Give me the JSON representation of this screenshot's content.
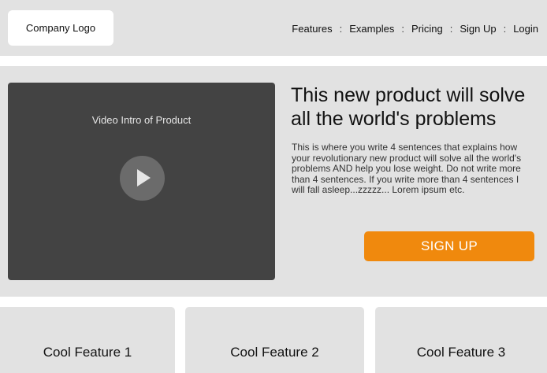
{
  "header": {
    "logo_text": "Company Logo",
    "nav": [
      "Features",
      "Examples",
      "Pricing",
      "Sign Up",
      "Login"
    ],
    "separator": ":"
  },
  "hero": {
    "video_caption": "Video Intro of Product",
    "play_icon": "play-icon",
    "headline": "This new product will solve all the world's problems",
    "body": "This is where you write 4 sentences that explains how your revolutionary new product will solve all the world's problems AND help you lose weight. Do not write more than 4 sentences.  If you write more than 4 sentences I will fall asleep...zzzzz... Lorem ipsum etc.",
    "cta_label": "SIGN UP"
  },
  "features": [
    {
      "title": "Cool Feature 1"
    },
    {
      "title": "Cool Feature 2"
    },
    {
      "title": "Cool Feature 3"
    }
  ],
  "colors": {
    "panel_bg": "#e2e2e2",
    "video_bg": "#434343",
    "cta_accent": "#f0890d"
  }
}
